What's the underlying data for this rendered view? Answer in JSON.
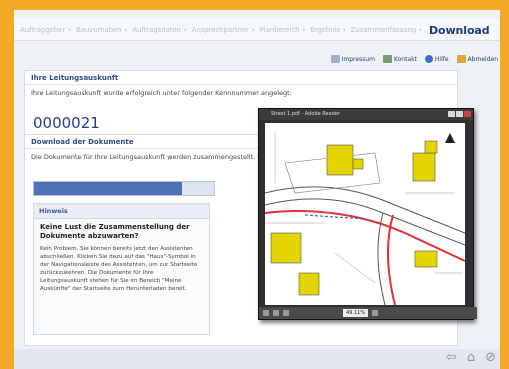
{
  "breadcrumb": {
    "items": [
      "Auftraggeber",
      "Bauvorhaben",
      "Auftragsdaten",
      "Ansprechpartner",
      "Planbereich",
      "Ergebnis",
      "Zusammenfassung"
    ],
    "current": "Download"
  },
  "toolbar": {
    "impressum": "Impressum",
    "kontakt": "Kontakt",
    "hilfe": "Hilfe",
    "abmelden": "Abmelden"
  },
  "section1": {
    "heading": "Ihre Leitungsauskunft",
    "text": "Ihre Leitungsauskunft wurde erfolgreich unter folgender Kennnummer angelegt:",
    "number": "0000021"
  },
  "section2": {
    "heading": "Download der Dokumente",
    "text": "Die Dokumente für Ihre Leitungsauskunft werden zusammengestellt. Bitte warten Sie.",
    "progress": 0.82
  },
  "hint": {
    "title": "Hinweis",
    "question": "Keine Lust die Zusammenstellung der Dokumente abzuwarten?",
    "body": "Kein Problem. Sie können bereits jetzt den Assistenten abschließen. Klicken Sie dazu auf das \"Haus\"-Symbol in der Navigationsleiste des Assistenten, um zur Startseite zurückzukehren. Die Dokumente für Ihre Leitungsauskunft stehen für Sie im Bereich \"Meine Auskünfte\" der Startseite zum Herunterladen bereit."
  },
  "viewer": {
    "title": "Sheet 1.pdf - Adobe Reader",
    "zoom": "49.11%"
  },
  "footer_icons": [
    "back-arrow-icon",
    "home-icon",
    "cancel-icon"
  ],
  "colors": {
    "accent_orange": "#f2a928",
    "heading_blue": "#2e4a8a",
    "progress_blue": "#4e72b8",
    "map_building": "#e6d400",
    "map_red_line": "#e0303a"
  }
}
